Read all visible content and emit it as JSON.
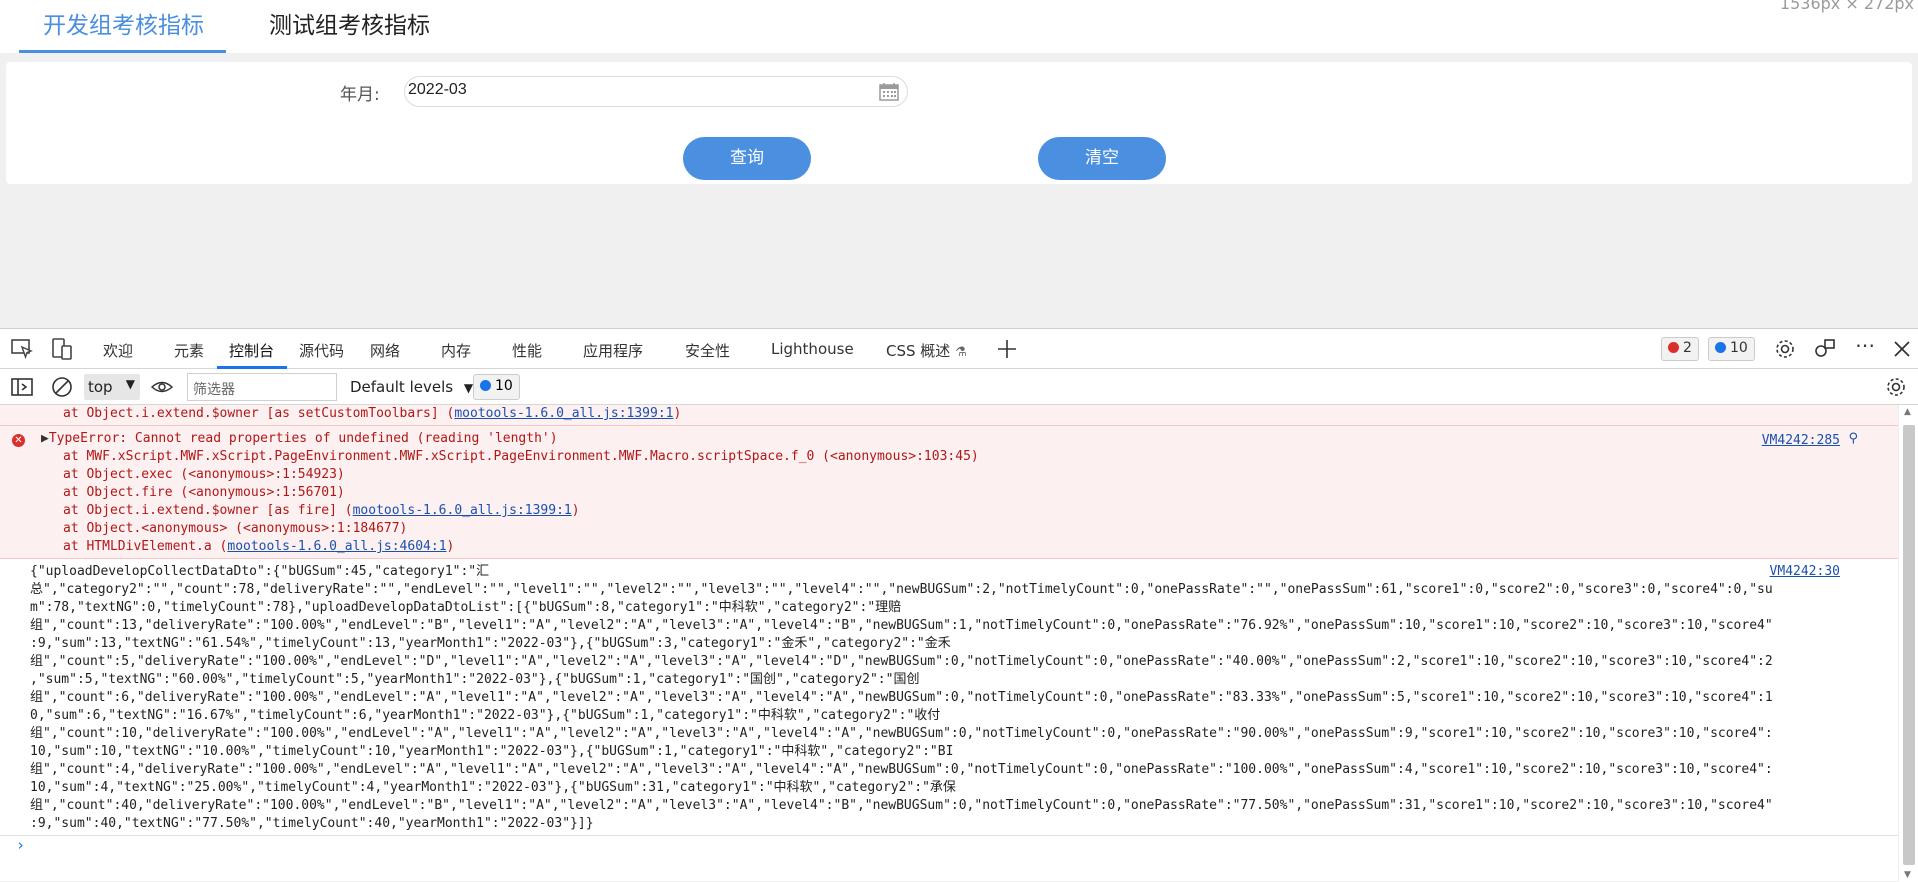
{
  "page": {
    "tabs": [
      {
        "label": "开发组考核指标",
        "active": true
      },
      {
        "label": "测试组考核指标",
        "active": false
      }
    ],
    "dimension_text": "1536px × 272px",
    "form": {
      "year_month_label": "年月:",
      "year_month_value": "2022-03",
      "query_button": "查询",
      "clear_button": "清空"
    },
    "accent_color": "#4a8fe0"
  },
  "devtools": {
    "tabs": [
      "欢迎",
      "元素",
      "控制台",
      "源代码",
      "网络",
      "内存",
      "性能",
      "应用程序",
      "安全性",
      "Lighthouse",
      "CSS 概述"
    ],
    "active_tab": "控制台",
    "error_count": "2",
    "message_count": "10",
    "toolbar": {
      "context": "top",
      "filter_placeholder": "筛选器",
      "levels": "Default levels",
      "levels_badge": "10"
    },
    "console": {
      "error1_tail": {
        "prefix": "at Object.i.extend.$owner [as setCustomToolbars] (",
        "link": "mootools-1.6.0_all.js:1399:1",
        "suffix": ")"
      },
      "error2": {
        "message": "TypeError: Cannot read properties of undefined (reading 'length')",
        "source": "VM4242:285",
        "stack": [
          {
            "prefix": "at MWF.xScript.MWF.xScript.PageEnvironment.MWF.xScript.PageEnvironment.MWF.Macro.scriptSpace.f_0 (<anonymous>:103:45)",
            "link": "",
            "suffix": ""
          },
          {
            "prefix": "at Object.exec (<anonymous>:1:54923)",
            "link": "",
            "suffix": ""
          },
          {
            "prefix": "at Object.fire (<anonymous>:1:56701)",
            "link": "",
            "suffix": ""
          },
          {
            "prefix": "at Object.i.extend.$owner [as fire] (",
            "link": "mootools-1.6.0_all.js:1399:1",
            "suffix": ")"
          },
          {
            "prefix": "at Object.<anonymous> (<anonymous>:1:184677)",
            "link": "",
            "suffix": ""
          },
          {
            "prefix": "at HTMLDivElement.a (",
            "link": "mootools-1.6.0_all.js:4604:1",
            "suffix": ")"
          }
        ]
      },
      "log": {
        "source": "VM4242:30",
        "lines": [
          "{\"uploadDevelopCollectDataDto\":{\"bUGSum\":45,\"category1\":\"汇",
          "总\",\"category2\":\"\",\"count\":78,\"deliveryRate\":\"\",\"endLevel\":\"\",\"level1\":\"\",\"level2\":\"\",\"level3\":\"\",\"level4\":\"\",\"newBUGSum\":2,\"notTimelyCount\":0,\"onePassRate\":\"\",\"onePassSum\":61,\"score1\":0,\"score2\":0,\"score3\":0,\"score4\":0,\"su",
          "m\":78,\"textNG\":0,\"timelyCount\":78},\"uploadDevelopDataDtoList\":[{\"bUGSum\":8,\"category1\":\"中科软\",\"category2\":\"理赔",
          "组\",\"count\":13,\"deliveryRate\":\"100.00%\",\"endLevel\":\"B\",\"level1\":\"A\",\"level2\":\"A\",\"level3\":\"A\",\"level4\":\"B\",\"newBUGSum\":1,\"notTimelyCount\":0,\"onePassRate\":\"76.92%\",\"onePassSum\":10,\"score1\":10,\"score2\":10,\"score3\":10,\"score4\"",
          ":9,\"sum\":13,\"textNG\":\"61.54%\",\"timelyCount\":13,\"yearMonth1\":\"2022-03\"},{\"bUGSum\":3,\"category1\":\"金禾\",\"category2\":\"金禾",
          "组\",\"count\":5,\"deliveryRate\":\"100.00%\",\"endLevel\":\"D\",\"level1\":\"A\",\"level2\":\"A\",\"level3\":\"A\",\"level4\":\"D\",\"newBUGSum\":0,\"notTimelyCount\":0,\"onePassRate\":\"40.00%\",\"onePassSum\":2,\"score1\":10,\"score2\":10,\"score3\":10,\"score4\":2",
          ",\"sum\":5,\"textNG\":\"60.00%\",\"timelyCount\":5,\"yearMonth1\":\"2022-03\"},{\"bUGSum\":1,\"category1\":\"国创\",\"category2\":\"国创",
          "组\",\"count\":6,\"deliveryRate\":\"100.00%\",\"endLevel\":\"A\",\"level1\":\"A\",\"level2\":\"A\",\"level3\":\"A\",\"level4\":\"A\",\"newBUGSum\":0,\"notTimelyCount\":0,\"onePassRate\":\"83.33%\",\"onePassSum\":5,\"score1\":10,\"score2\":10,\"score3\":10,\"score4\":1",
          "0,\"sum\":6,\"textNG\":\"16.67%\",\"timelyCount\":6,\"yearMonth1\":\"2022-03\"},{\"bUGSum\":1,\"category1\":\"中科软\",\"category2\":\"收付",
          "组\",\"count\":10,\"deliveryRate\":\"100.00%\",\"endLevel\":\"A\",\"level1\":\"A\",\"level2\":\"A\",\"level3\":\"A\",\"level4\":\"A\",\"newBUGSum\":0,\"notTimelyCount\":0,\"onePassRate\":\"90.00%\",\"onePassSum\":9,\"score1\":10,\"score2\":10,\"score3\":10,\"score4\":",
          "10,\"sum\":10,\"textNG\":\"10.00%\",\"timelyCount\":10,\"yearMonth1\":\"2022-03\"},{\"bUGSum\":1,\"category1\":\"中科软\",\"category2\":\"BI",
          "组\",\"count\":4,\"deliveryRate\":\"100.00%\",\"endLevel\":\"A\",\"level1\":\"A\",\"level2\":\"A\",\"level3\":\"A\",\"level4\":\"A\",\"newBUGSum\":0,\"notTimelyCount\":0,\"onePassRate\":\"100.00%\",\"onePassSum\":4,\"score1\":10,\"score2\":10,\"score3\":10,\"score4\":",
          "10,\"sum\":4,\"textNG\":\"25.00%\",\"timelyCount\":4,\"yearMonth1\":\"2022-03\"},{\"bUGSum\":31,\"category1\":\"中科软\",\"category2\":\"承保",
          "组\",\"count\":40,\"deliveryRate\":\"100.00%\",\"endLevel\":\"B\",\"level1\":\"A\",\"level2\":\"A\",\"level3\":\"A\",\"level4\":\"B\",\"newBUGSum\":0,\"notTimelyCount\":0,\"onePassRate\":\"77.50%\",\"onePassSum\":31,\"score1\":10,\"score2\":10,\"score3\":10,\"score4\"",
          ":9,\"sum\":40,\"textNG\":\"77.50%\",\"timelyCount\":40,\"yearMonth1\":\"2022-03\"}]}"
        ]
      },
      "prompt_symbol": "›"
    }
  }
}
